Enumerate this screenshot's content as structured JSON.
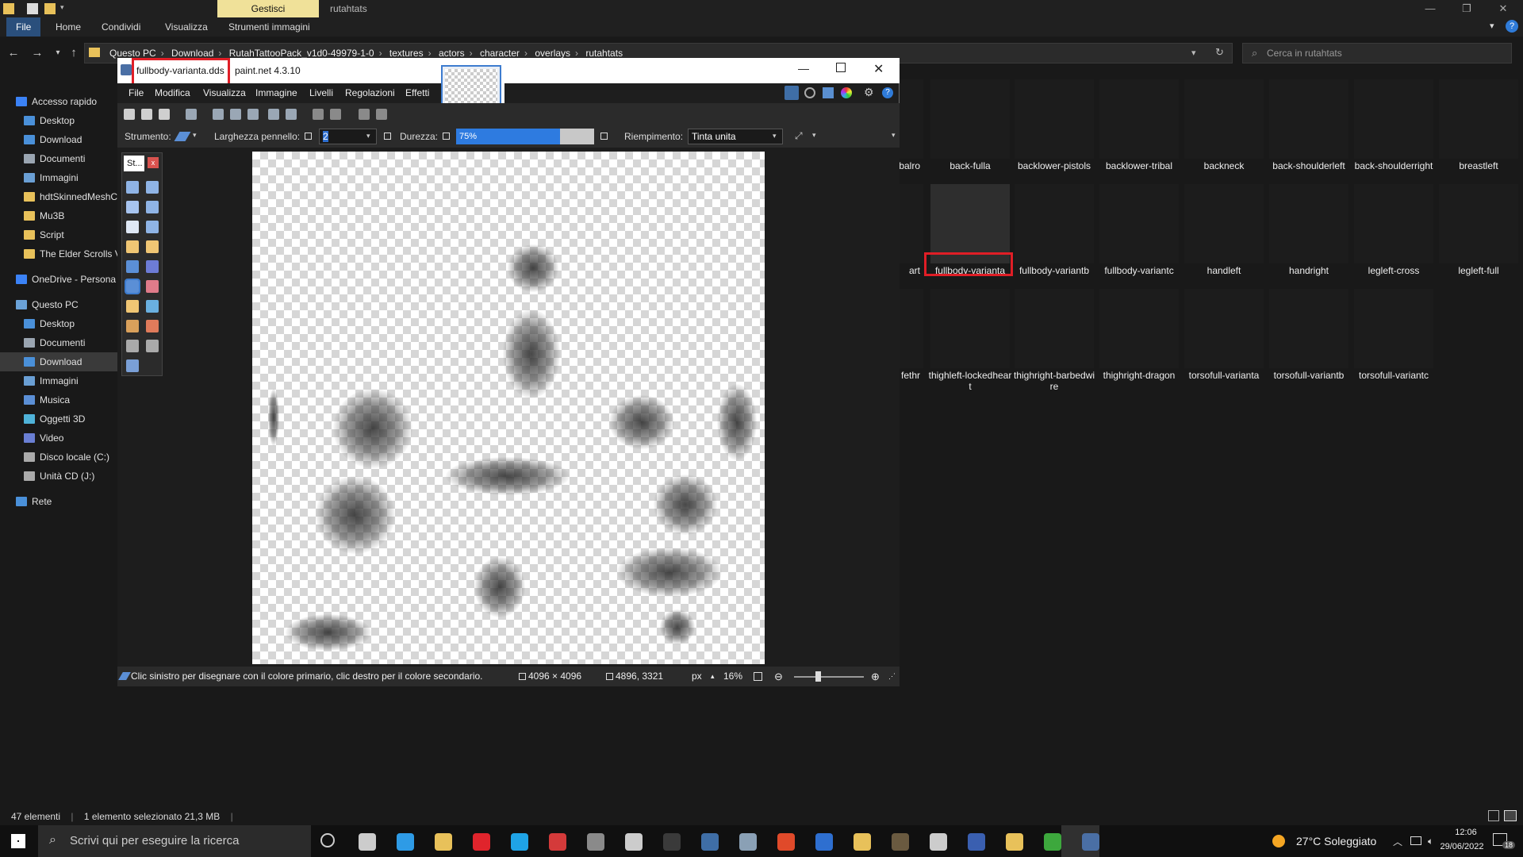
{
  "explorer": {
    "context_tab": "Gestisci",
    "window_title": "rutahtats",
    "ribbon_tabs": [
      "File",
      "Home",
      "Condividi",
      "Visualizza",
      "Strumenti immagini"
    ],
    "breadcrumbs": [
      "Questo PC",
      "Download",
      "RutahTattooPack_v1d0-49979-1-0",
      "textures",
      "actors",
      "character",
      "overlays",
      "rutahtats"
    ],
    "search_placeholder": "Cerca in rutahtats",
    "sidebar": [
      {
        "label": "Accesso rapido",
        "icon": "star-icon",
        "color": "#3b82f6"
      },
      {
        "label": "Desktop",
        "icon": "desktop-icon",
        "color": "#4a90d9"
      },
      {
        "label": "Download",
        "icon": "download-icon",
        "color": "#4a90d9"
      },
      {
        "label": "Documenti",
        "icon": "document-icon",
        "color": "#9aa5b1"
      },
      {
        "label": "Immagini",
        "icon": "images-icon",
        "color": "#6a9fd4"
      },
      {
        "label": "hdtSkinnedMeshC",
        "icon": "folder-icon",
        "color": "#e8c15a"
      },
      {
        "label": "Mu3B",
        "icon": "folder-icon",
        "color": "#e8c15a"
      },
      {
        "label": "Script",
        "icon": "folder-icon",
        "color": "#e8c15a"
      },
      {
        "label": "The Elder Scrolls V",
        "icon": "folder-icon",
        "color": "#e8c15a"
      },
      {
        "label": "OneDrive - Persona",
        "icon": "cloud-icon",
        "color": "#3b82f6"
      },
      {
        "label": "Questo PC",
        "icon": "pc-icon",
        "color": "#6aa2d8"
      },
      {
        "label": "Desktop",
        "icon": "desktop-icon",
        "color": "#4a90d9"
      },
      {
        "label": "Documenti",
        "icon": "document-icon",
        "color": "#9aa5b1"
      },
      {
        "label": "Download",
        "icon": "download-icon",
        "color": "#4a90d9"
      },
      {
        "label": "Immagini",
        "icon": "images-icon",
        "color": "#6a9fd4"
      },
      {
        "label": "Musica",
        "icon": "music-icon",
        "color": "#5b8fd6"
      },
      {
        "label": "Oggetti 3D",
        "icon": "cube-icon",
        "color": "#4fb3d9"
      },
      {
        "label": "Video",
        "icon": "video-icon",
        "color": "#6a7fd4"
      },
      {
        "label": "Disco locale (C:)",
        "icon": "drive-icon",
        "color": "#aaaaaa"
      },
      {
        "label": "Unità CD (J:)",
        "icon": "cd-icon",
        "color": "#aaaaaa"
      },
      {
        "label": "Rete",
        "icon": "network-icon",
        "color": "#4a90d9"
      }
    ],
    "files_row1": [
      "balro",
      "back-fulla",
      "backlower-pistols",
      "backlower-tribal",
      "backneck",
      "back-shoulderleft",
      "back-shoulderright",
      "breastleft"
    ],
    "files_row2": [
      "art",
      "fullbody-varianta",
      "fullbody-variantb",
      "fullbody-variantc",
      "handleft",
      "handright",
      "legleft-cross",
      "legleft-full"
    ],
    "files_row3": [
      "fethr",
      "thighleft-lockedheart",
      "thighright-barbedwire",
      "thighright-dragon",
      "torsofull-varianta",
      "torsofull-variantb",
      "torsofull-variantc"
    ],
    "status_count": "47 elementi",
    "status_selected": "1 elemento selezionato  21,3 MB"
  },
  "paintnet": {
    "doc_name": "fullbody-varianta.dds",
    "app_version": "paint.net 4.3.10",
    "menu": [
      "File",
      "Modifica",
      "Visualizza",
      "Immagine",
      "Livelli",
      "Regolazioni",
      "Effetti"
    ],
    "tool_label": "Strumento:",
    "brush_width_label": "Larghezza pennello:",
    "brush_width_value": "2",
    "hardness_label": "Durezza:",
    "hardness_value": "75%",
    "hardness_fraction": 0.75,
    "fill_label": "Riempimento:",
    "fill_value": "Tinta unita",
    "toolbox_title": "St...",
    "status_hint": "Clic sinistro per disegnare con il colore primario, clic destro per il colore secondario.",
    "image_size": "4096 × 4096",
    "cursor_pos": "4896, 3321",
    "unit": "px",
    "zoom": "16%"
  },
  "taskbar": {
    "search_placeholder": "Scrivi qui per eseguire la ricerca",
    "weather": "27°C  Soleggiato",
    "time": "12:06",
    "date": "29/06/2022",
    "notification_count": "18"
  },
  "colors": {
    "highlight_red": "#e01e26",
    "ctx_tab": "#f0e199",
    "accent_blue": "#2a4f7c"
  }
}
